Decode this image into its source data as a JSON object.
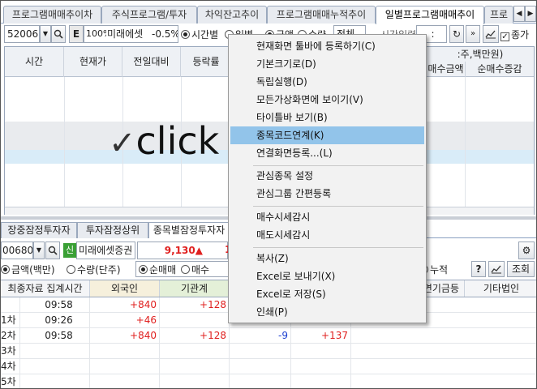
{
  "top_tabs": [
    "프로그램매매추이차",
    "주식프로그램/투자",
    "차익잔고추이",
    "프로그램매매누적추이",
    "일별프로그램매매추이",
    "프로"
  ],
  "active_top_tab": 4,
  "toolbar": {
    "code": "520063",
    "e_badge": "E",
    "pct": "100%",
    "name": "미래에셋",
    "change": "-0.5%",
    "radio_time": "시간별",
    "radio_daily": "일별",
    "radio_amount": "금액",
    "radio_qty": "수량",
    "select_all": "전체",
    "time_interval_label": "시간입력",
    "time_value": ":",
    "check_label": "종가"
  },
  "top_grid": {
    "headers": [
      "시간",
      "현재가",
      "전일대비",
      "등락률"
    ],
    "unit_label": ":주,백만원)",
    "right_headers": [
      "매수금액",
      "순매수증감"
    ]
  },
  "click_label": "click",
  "bottom_tabs": [
    "장중잠정투자자",
    "투자잠정상위",
    "종목별잠정투자자"
  ],
  "active_bottom_tab": 2,
  "stock_bar": {
    "code": "006800",
    "badge": "신",
    "name": "미래에셋증권",
    "price": "9,130",
    "arrow": "▲",
    "partial": "1"
  },
  "options_bar": {
    "radio_amount": "금액(백만)",
    "radio_qty": "수량(단주)",
    "radio_net": "순매매",
    "radio_buy": "매수",
    "radio_cum": "누적",
    "help": "?",
    "query_button": "조회"
  },
  "bottom_grid": {
    "headers": [
      "최종자료 집계시간",
      "외국인",
      "기관계",
      "",
      "",
      "연기금등",
      "기타법인"
    ],
    "rows": [
      {
        "label": "",
        "time": "09:58",
        "foreign": "+840",
        "inst": "+128",
        "c4": "",
        "c5": ""
      },
      {
        "label": "1차",
        "time": "09:26",
        "foreign": "+46",
        "inst": "",
        "c4": "",
        "c5": ""
      },
      {
        "label": "2차",
        "time": "09:58",
        "foreign": "+840",
        "inst": "+128",
        "c4": "-9",
        "c5": "+137"
      },
      {
        "label": "3차",
        "time": "",
        "foreign": "",
        "inst": "",
        "c4": "",
        "c5": ""
      },
      {
        "label": "4차",
        "time": "",
        "foreign": "",
        "inst": "",
        "c4": "",
        "c5": ""
      },
      {
        "label": "5차",
        "time": "",
        "foreign": "",
        "inst": "",
        "c4": "",
        "c5": ""
      }
    ]
  },
  "context_menu": {
    "items": [
      "현재화면 툴바에 등록하기(C)",
      "기본크기로(D)",
      "독립실행(D)",
      "모든가상화면에 보이기(V)",
      "타이틀바 보기(B)",
      "종목코드연계(K)",
      "연결화면등록...(L)",
      "관심종목 설정",
      "관심그룹 간편등록",
      "매수시세감시",
      "매도시세감시",
      "복사(Z)",
      "Excel로 보내기(X)",
      "Excel로 저장(S)",
      "인쇄(P)"
    ],
    "highlighted_index": 5
  },
  "colors": {
    "up": "#e0201f",
    "down": "#1c3fd0",
    "highlight": "#92c4ea",
    "foreign_header": "#f6f0dc",
    "inst_header": "#e4f0d8"
  }
}
